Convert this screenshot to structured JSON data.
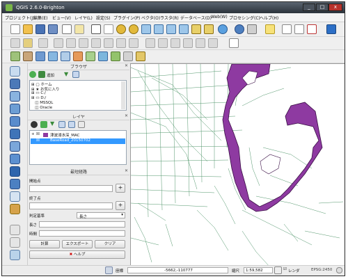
{
  "window": {
    "title": "QGIS 2.6.0-Brighton",
    "min": "_",
    "max": "□",
    "close": "x"
  },
  "menu": [
    "プロジェクト(J)",
    "編集(E)",
    "ビュー(V)",
    "レイヤ(L)",
    "設定(S)",
    "プラグイン(P)",
    "ベクタ(O)",
    "ラスタ(R)",
    "データベース(D)",
    "Web(W)",
    "プロセシング(C)",
    "ヘルプ(H)"
  ],
  "browser": {
    "title": "ブラウザ",
    "add_label": "追加",
    "items": [
      "ホーム",
      "お気に入り",
      "C:/",
      "D:/",
      "MSSQL",
      "Oracle"
    ]
  },
  "layers": {
    "title": "レイヤ",
    "items": [
      {
        "name": "津波浸水深_MAC",
        "color": "#8e3aa1"
      },
      {
        "name": "BaseRoad_20150702",
        "color": "#3d8a5a"
      }
    ]
  },
  "route": {
    "title": "最短経路",
    "start_label": "開始点",
    "end_label": "終了点",
    "criterion_label": "判定基準",
    "criterion_value": "長さ",
    "length_label": "長さ",
    "time_label": "時間",
    "calc_button": "計算",
    "export_button": "エクスポート",
    "clear_button": "クリア",
    "help_button": "ヘルプ"
  },
  "statusbar": {
    "coord_label": "座標",
    "coord_value": "-5662,-110777",
    "scale_label": "縮尺",
    "scale_value": "1:59,582",
    "render_label": "レンダ",
    "crs": "EPSG:2450"
  },
  "colors": {
    "flood": "#8e3aa1",
    "roads": "#3d8a5a",
    "accent": "#3399ff"
  }
}
